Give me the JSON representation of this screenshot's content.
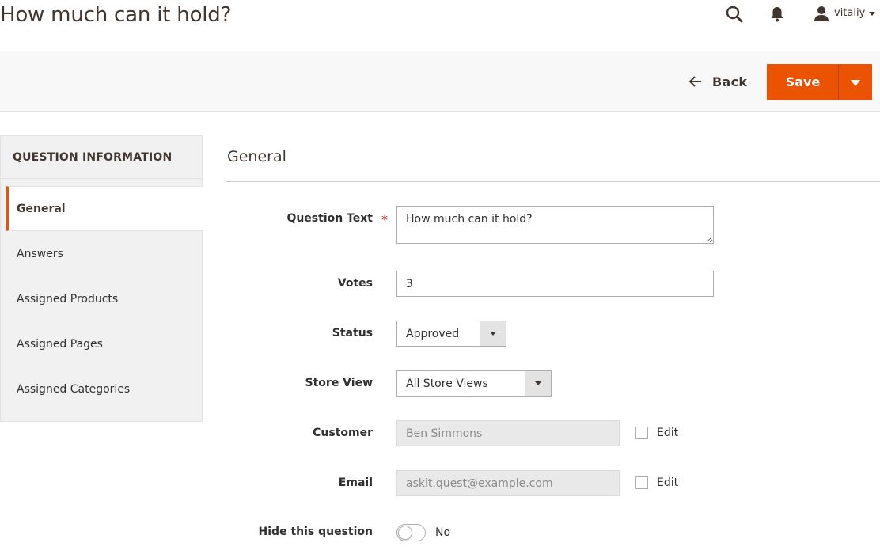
{
  "page": {
    "title": "How much can it hold?"
  },
  "header": {
    "user_name": "vitaliy"
  },
  "actions": {
    "back_label": "Back",
    "save_label": "Save"
  },
  "sidebar": {
    "title": "QUESTION INFORMATION",
    "tabs": [
      {
        "label": "General"
      },
      {
        "label": "Answers"
      },
      {
        "label": "Assigned Products"
      },
      {
        "label": "Assigned Pages"
      },
      {
        "label": "Assigned Categories"
      }
    ]
  },
  "form": {
    "section_title": "General",
    "question_text": {
      "label": "Question Text",
      "value": "How much can it hold?"
    },
    "votes": {
      "label": "Votes",
      "value": "3"
    },
    "status": {
      "label": "Status",
      "value": "Approved"
    },
    "store_view": {
      "label": "Store View",
      "value": "All Store Views"
    },
    "customer": {
      "label": "Customer",
      "value": "Ben Simmons",
      "edit_label": "Edit"
    },
    "email": {
      "label": "Email",
      "value": "askit.quest@example.com",
      "edit_label": "Edit"
    },
    "hide": {
      "label": "Hide this question",
      "value_label": "No"
    }
  },
  "colors": {
    "accent": "#eb5202",
    "required": "#e22626"
  }
}
